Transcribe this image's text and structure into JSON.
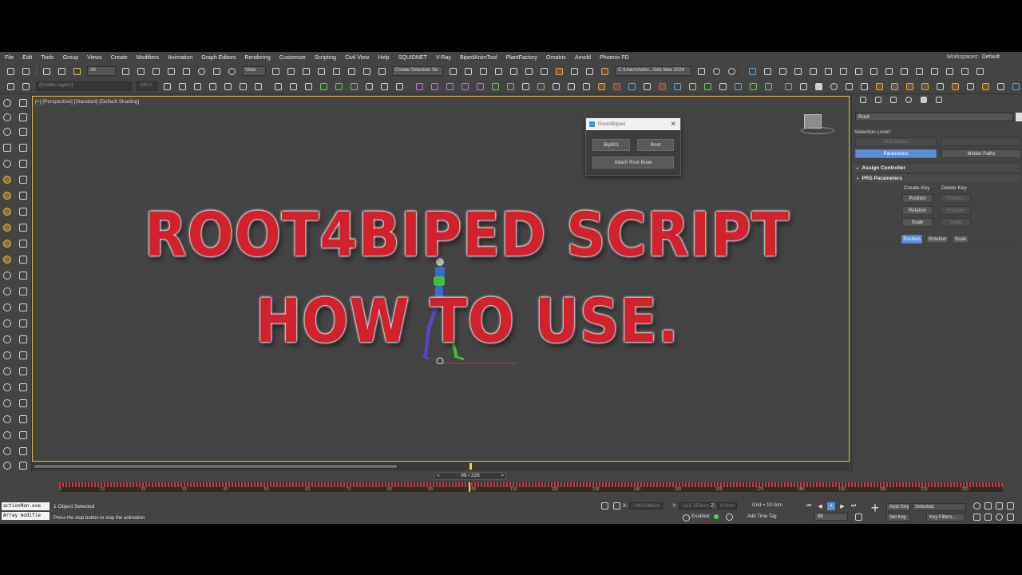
{
  "menu": {
    "items": [
      "File",
      "Edit",
      "Tools",
      "Group",
      "Views",
      "Create",
      "Modifiers",
      "Animation",
      "Graph Editors",
      "Rendering",
      "Customize",
      "Scripting",
      "Civil View",
      "Help",
      "SQUIDNET",
      "V-Ray",
      "BipedAnimTool",
      "PlantFactory",
      "Ornatrix",
      "Arnold",
      "Phoenix FD"
    ],
    "workspaces_label": "Workspaces:",
    "workspaces_value": "Default"
  },
  "toolbar": {
    "selection_filter": "All",
    "ref_coord": "View",
    "selection_set": "Create Selection Se",
    "project_path": "C:\\Users\\Admi...\\3ds Max 2024",
    "layer_field": "(Enable Layers)",
    "layer_value": "100.0"
  },
  "viewport": {
    "label": "[+] [Perspective] [Standard] [Default Shading]",
    "title_line1": "ROOT4BIPED SCRIPT",
    "title_line2": "HOW TO USE."
  },
  "dialog": {
    "title": "Root4Biped",
    "btn_bip": "Bip001",
    "btn_root": "Root",
    "btn_attach": "Attach Root Bone"
  },
  "command_panel": {
    "object_name": "Root",
    "selection_level": "Selection Level:",
    "sub_object": "Sub-Object",
    "tab_parameters": "Parameters",
    "tab_motion_paths": "Motion Paths",
    "assign_controller": "Assign Controller",
    "prs_parameters": "PRS Parameters",
    "create_key": "Create Key",
    "delete_key": "Delete Key",
    "create_position": "Position",
    "create_rotation": "Rotation",
    "create_scale": "Scale",
    "delete_position": "Position",
    "delete_rotation": "Rotation",
    "delete_scale": "Scale",
    "mode_position": "Position",
    "mode_rotation": "Rotation",
    "mode_scale": "Scale"
  },
  "timeline": {
    "frame_display": "99 / 228",
    "prev": "<",
    "next": ">",
    "current_frame": 99,
    "total_frames": 228,
    "ticks": [
      "0",
      "13",
      "23",
      "33",
      "43",
      "53",
      "63",
      "73",
      "83",
      "93",
      "100",
      "110",
      "120",
      "130",
      "140",
      "150",
      "160",
      "170",
      "180",
      "190",
      "200",
      "210",
      "220"
    ]
  },
  "status": {
    "maxscript_line1": "actionMan.exe",
    "maxscript_line2": "Array modifie",
    "selection": "1 Object Selected",
    "prompt": "Press the stop button to stop the animation",
    "x_label": "X:",
    "x_value": "-240.846cm",
    "y_label": "Y:",
    "y_value": "-115.153cm",
    "z_label": "Z:",
    "z_value": "0.0cm",
    "grid": "Grid = 10.0cm",
    "enabled_label": "Enabled:",
    "add_time_tag": "Add Time Tag",
    "auto_key": "Auto Key",
    "set_key": "Set Key",
    "key_mode": "Selected",
    "key_filters": "Key Filters...",
    "frame_field": "98"
  },
  "colors": {
    "viewport_border": "#e7b43a",
    "title_red": "#d0212c",
    "accent_blue": "#5b8ed4",
    "key_red": "#c63b3b",
    "time_yellow": "#f0d23a"
  }
}
